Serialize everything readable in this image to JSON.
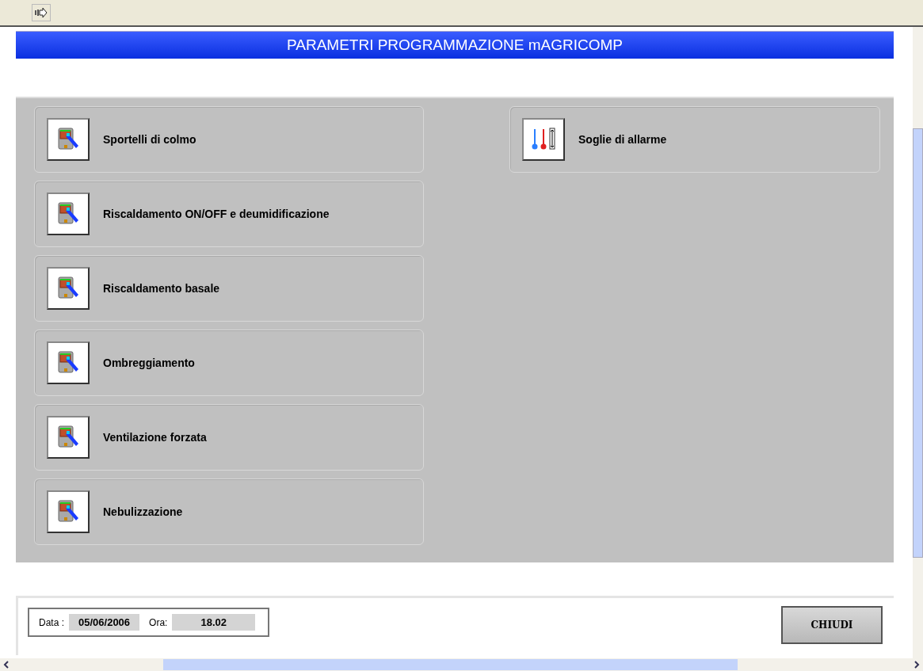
{
  "title": "PARAMETRI PROGRAMMAZIONE mAGRICOMP",
  "columns": [
    [
      {
        "kind": "controller",
        "label": "Sportelli di colmo"
      },
      {
        "kind": "controller",
        "label": "Riscaldamento ON/OFF e deumidificazione"
      },
      {
        "kind": "controller",
        "label": "Riscaldamento basale"
      },
      {
        "kind": "controller",
        "label": "Ombreggiamento"
      },
      {
        "kind": "controller",
        "label": "Ventilazione forzata"
      },
      {
        "kind": "controller",
        "label": "Nebulizzazione"
      }
    ],
    [
      {
        "kind": "thresholds",
        "label": "Soglie di allarme"
      }
    ]
  ],
  "status": {
    "date_label": "Data :",
    "date": "05/06/2006",
    "time_label": "Ora:",
    "time": "18.02"
  },
  "close_button": "CHIUDI"
}
